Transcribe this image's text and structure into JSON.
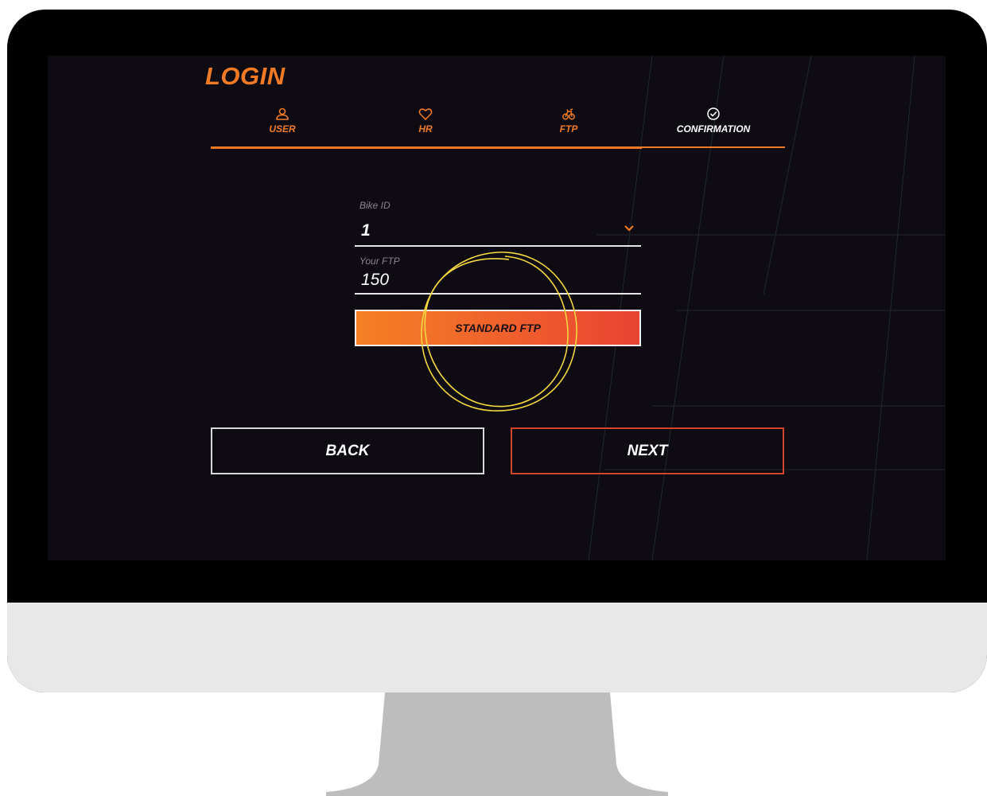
{
  "screen": {
    "title": "LOGIN",
    "steps": [
      {
        "label": "USER",
        "icon": "user-icon",
        "state": "done"
      },
      {
        "label": "HR",
        "icon": "heart-icon",
        "state": "done"
      },
      {
        "label": "FTP",
        "icon": "bike-icon",
        "state": "done"
      },
      {
        "label": "CONFIRMATION",
        "icon": "check-circle-icon",
        "state": "current"
      }
    ],
    "form": {
      "bike_id": {
        "label": "Bike ID",
        "value": "1"
      },
      "ftp": {
        "label": "Your FTP",
        "value": "150"
      },
      "standard_ftp_label": "STANDARD FTP"
    },
    "nav": {
      "back_label": "BACK",
      "next_label": "NEXT"
    }
  },
  "colors": {
    "accent": "#f07a26",
    "button_gradient_start": "#f58025",
    "button_gradient_end": "#e84432",
    "highlight_circle": "#f5d742",
    "screen_bg": "#0e0b12",
    "bezel": "#000000",
    "chin": "#e8e8e8",
    "stand": "#bdbdbd"
  }
}
